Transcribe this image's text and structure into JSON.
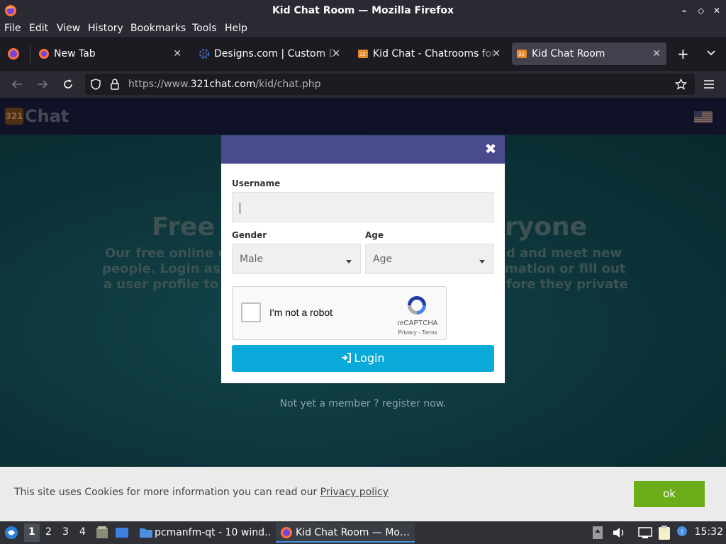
{
  "window": {
    "title": "Kid Chat Room — Mozilla Firefox",
    "controls": [
      "–",
      "◇",
      "✕"
    ]
  },
  "menu": [
    "File",
    "Edit",
    "View",
    "History",
    "Bookmarks",
    "Tools",
    "Help"
  ],
  "tabs": [
    {
      "label": "New Tab",
      "icon": "firefox-icon"
    },
    {
      "label": "Designs.com | Custom Designs",
      "icon": "designs-icon"
    },
    {
      "label": "Kid Chat - Chatrooms for Kids",
      "icon": "321chat-icon"
    },
    {
      "label": "Kid Chat Room",
      "icon": "321chat-icon",
      "active": true
    }
  ],
  "url": {
    "prefix": "https://www.",
    "domain": "321chat.com",
    "path": "/kid/chat.php"
  },
  "site": {
    "logo_badge": "321",
    "logo_text": "Chat"
  },
  "hero": {
    "title_left": "Free",
    "title_right": "ryone",
    "line1_left": "Our free online c",
    "line1_right": "d and meet new",
    "line2_left": "people. Login as",
    "line2_right": "mation or fill out",
    "line3_left": "a user profile to",
    "line3_right": "fore they private",
    "not_member": "Not yet a member ? register now."
  },
  "modal": {
    "username_label": "Username",
    "username_value": "",
    "gender_label": "Gender",
    "gender_value": "Male",
    "age_label": "Age",
    "age_value": "Age",
    "captcha_label": "I'm not a robot",
    "captcha_brand": "reCAPTCHA",
    "captcha_terms": "Privacy - Terms",
    "login_label": "Login"
  },
  "cookie": {
    "text": "This site uses Cookies for more information you can read our ",
    "link": "Privacy policy",
    "ok": "ok"
  },
  "taskbar": {
    "workspaces": [
      "1",
      "2",
      "3",
      "4"
    ],
    "tasks": [
      "pcmanfm-qt - 10 wind…",
      "Kid Chat Room — Mo…"
    ],
    "clock": "15:32"
  },
  "colors": {
    "modal_header": "#4a4a8f",
    "login_button": "#09a9d9",
    "cookie_ok": "#6cae1a",
    "tab_active": "#42414d"
  }
}
